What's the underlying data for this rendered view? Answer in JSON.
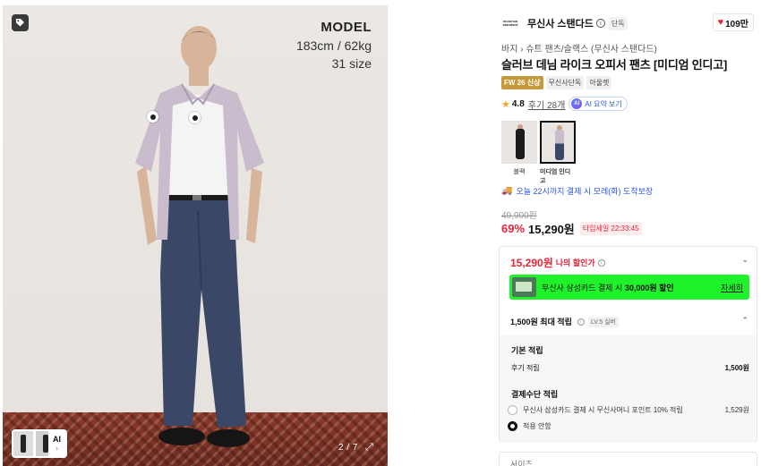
{
  "gallery": {
    "model_title": "MODEL",
    "model_body": "183cm / 62kg",
    "model_size": "31 size",
    "counter": "2 / 7",
    "thumb_ai_label": "AI",
    "thumb_ai_chevron": "›"
  },
  "brand": {
    "logo_line1": "musinsa",
    "logo_line2": "standard",
    "name": "무신사 스탠다드",
    "exclusive_badge": "단독",
    "likes": "109만"
  },
  "product": {
    "breadcrumb_1": "바지",
    "breadcrumb_sep": "›",
    "breadcrumb_2": "슈트 팬츠/슬랙스 (무신사 스탠다드)",
    "title": "슬러브 데님 라이크 오피서 팬츠 [미디엄 인디고]",
    "tags": [
      "FW 26 신상",
      "무신사단독",
      "아울렛"
    ],
    "rating": "4.8",
    "reviews": "후기 28개",
    "ai_summary": "AI 요약 보기",
    "ai_icon": "AI",
    "colors": [
      {
        "label": "블랙",
        "selected": false
      },
      {
        "label": "미디엄 인디고",
        "selected": true
      }
    ],
    "delivery": "오늘 22시까지 결제 시 모레(화) 도착보장"
  },
  "pricing": {
    "original": "49,900원",
    "discount": "69%",
    "price": "15,290원",
    "timesale": "타임세일 22:33:45"
  },
  "benefit": {
    "my_price_value": "15,290원",
    "my_price_label": "나의 할인가",
    "card_text_prefix": "무신사 삼성카드 결제 시 ",
    "card_text_bold": "30,000원 할인",
    "card_more": "자세히",
    "points_title": "1,500원 최대 적립",
    "points_level": "LV.5 실버",
    "basic_title": "기본 적립",
    "review_points_label": "후기 적립",
    "review_points_value": "1,500원",
    "payment_title": "결제수단 적립",
    "payment_options": [
      {
        "label": "무신사 삼성카드 결제 시 무신사머니 포인트 10% 적립",
        "value": "1,529원",
        "selected": false
      },
      {
        "label": "적용 안함",
        "value": "",
        "selected": true
      }
    ]
  },
  "size_select": {
    "placeholder": "사이즈"
  },
  "colors": {
    "discount_red": "#e8233a",
    "card_banner": "#1ff22b",
    "link_blue": "#2c56e8",
    "season_tag": "#c69a3b"
  }
}
